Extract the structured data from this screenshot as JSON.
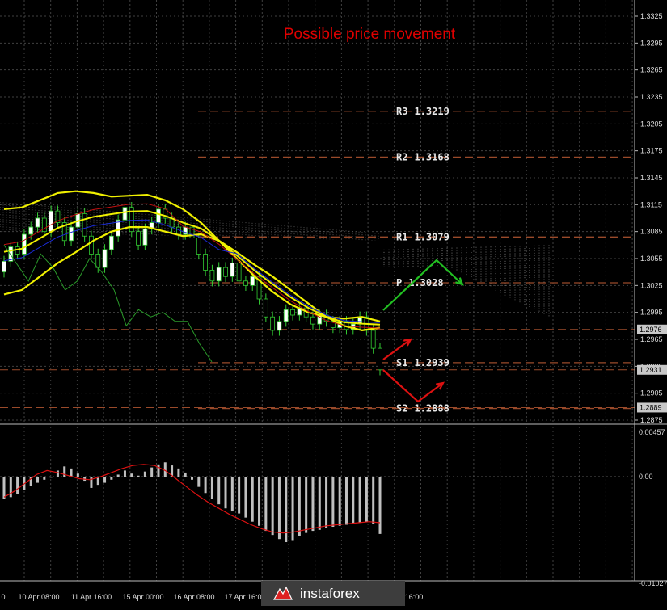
{
  "title": "Possible price movement",
  "colors": {
    "background": "#000000",
    "grid": "#404040",
    "title": "#e00000",
    "bands": "#f0f000",
    "green": "#22c022",
    "red": "#dd1111",
    "ma_red": "#c01010",
    "ma_blue": "#1a2bd8",
    "level": "#9a4a2a",
    "macd_hist": "#c0c0c0",
    "macd_signal": "#dd1111"
  },
  "price_axis": {
    "min": 1.2865,
    "max": 1.334,
    "ticks": [
      "1.3325",
      "1.3295",
      "1.3265",
      "1.3235",
      "1.3205",
      "1.3175",
      "1.3145",
      "1.3115",
      "1.3085",
      "1.3055",
      "1.3025",
      "1.2995",
      "1.2965",
      "1.2935",
      "1.2905",
      "1.2875"
    ],
    "tick_values": [
      1.3325,
      1.3295,
      1.3265,
      1.3235,
      1.3205,
      1.3175,
      1.3145,
      1.3115,
      1.3085,
      1.3055,
      1.3025,
      1.2995,
      1.2965,
      1.2935,
      1.2905,
      1.2875
    ],
    "badges": [
      {
        "label": "1.2976",
        "value": 1.2976
      },
      {
        "label": "1.2931",
        "value": 1.2931
      },
      {
        "label": "1.2889",
        "value": 1.2889
      }
    ]
  },
  "levels": [
    {
      "label": "R3",
      "value_text": "1.3219",
      "value": 1.3219
    },
    {
      "label": "R2",
      "value_text": "1.3168",
      "value": 1.3168
    },
    {
      "label": "R1",
      "value_text": "1.3079",
      "value": 1.3079
    },
    {
      "label": "P",
      "value_text": "1.3028",
      "value": 1.3028
    },
    {
      "label": "S1",
      "value_text": "1.2939",
      "value": 1.2939
    },
    {
      "label": "S2",
      "value_text": "1.2888",
      "value": 1.2888
    }
  ],
  "time_axis": [
    "0",
    "10 Apr 08:00",
    "11 Apr 16:00",
    "15 Apr 00:00",
    "16 Apr 08:00",
    "17 Apr 16:00",
    "16:00"
  ],
  "macd_axis": {
    "min": -0.01027,
    "max": 0.00457,
    "ticks": [
      "0.00457",
      "0.00",
      "-0.01027"
    ],
    "tick_values": [
      0.00457,
      0.0,
      -0.01027
    ]
  },
  "chart_data": [
    {
      "type": "line",
      "title": "Possible price movement",
      "x_labels": [
        "10 Apr 08:00",
        "11 Apr 16:00",
        "15 Apr 00:00",
        "16 Apr 08:00",
        "17 Apr 16:00"
      ],
      "candles": [
        {
          "o": 1.304,
          "c": 1.3052
        },
        {
          "o": 1.3052,
          "c": 1.3068
        },
        {
          "o": 1.3068,
          "c": 1.306
        },
        {
          "o": 1.306,
          "c": 1.3082
        },
        {
          "o": 1.3082,
          "c": 1.309
        },
        {
          "o": 1.309,
          "c": 1.31
        },
        {
          "o": 1.31,
          "c": 1.3085
        },
        {
          "o": 1.3085,
          "c": 1.3108
        },
        {
          "o": 1.3108,
          "c": 1.3095
        },
        {
          "o": 1.3095,
          "c": 1.3075
        },
        {
          "o": 1.3075,
          "c": 1.309
        },
        {
          "o": 1.309,
          "c": 1.3105
        },
        {
          "o": 1.3105,
          "c": 1.308
        },
        {
          "o": 1.308,
          "c": 1.306
        },
        {
          "o": 1.306,
          "c": 1.3045
        },
        {
          "o": 1.3045,
          "c": 1.3065
        },
        {
          "o": 1.3065,
          "c": 1.308
        },
        {
          "o": 1.308,
          "c": 1.3098
        },
        {
          "o": 1.3098,
          "c": 1.3112
        },
        {
          "o": 1.3112,
          "c": 1.3085
        },
        {
          "o": 1.3085,
          "c": 1.307
        },
        {
          "o": 1.307,
          "c": 1.3088
        },
        {
          "o": 1.3088,
          "c": 1.3095
        },
        {
          "o": 1.3095,
          "c": 1.311
        },
        {
          "o": 1.311,
          "c": 1.31
        },
        {
          "o": 1.31,
          "c": 1.309
        },
        {
          "o": 1.309,
          "c": 1.3082
        },
        {
          "o": 1.3082,
          "c": 1.309
        },
        {
          "o": 1.309,
          "c": 1.3078
        },
        {
          "o": 1.3078,
          "c": 1.306
        },
        {
          "o": 1.306,
          "c": 1.3042
        },
        {
          "o": 1.3042,
          "c": 1.303
        },
        {
          "o": 1.303,
          "c": 1.3045
        },
        {
          "o": 1.3045,
          "c": 1.3035
        },
        {
          "o": 1.3035,
          "c": 1.305
        },
        {
          "o": 1.305,
          "c": 1.303
        },
        {
          "o": 1.303,
          "c": 1.3025
        },
        {
          "o": 1.3025,
          "c": 1.3035
        },
        {
          "o": 1.3035,
          "c": 1.301
        },
        {
          "o": 1.301,
          "c": 1.299
        },
        {
          "o": 1.299,
          "c": 1.2975
        },
        {
          "o": 1.2975,
          "c": 1.2985
        },
        {
          "o": 1.2985,
          "c": 1.2998
        },
        {
          "o": 1.2998,
          "c": 1.2992
        },
        {
          "o": 1.2992,
          "c": 1.3
        },
        {
          "o": 1.3,
          "c": 1.299
        },
        {
          "o": 1.299,
          "c": 1.2982
        },
        {
          "o": 1.2982,
          "c": 1.2992
        },
        {
          "o": 1.2992,
          "c": 1.2985
        },
        {
          "o": 1.2985,
          "c": 1.2978
        },
        {
          "o": 1.2978,
          "c": 1.2985
        },
        {
          "o": 1.2985,
          "c": 1.2976
        },
        {
          "o": 1.2976,
          "c": 1.2982
        },
        {
          "o": 1.2982,
          "c": 1.299
        },
        {
          "o": 1.299,
          "c": 1.2975
        },
        {
          "o": 1.2975,
          "c": 1.2955
        },
        {
          "o": 1.2955,
          "c": 1.2931
        }
      ],
      "series": [
        {
          "name": "",
          "values": [
            1.3015,
            1.302,
            1.3035,
            1.305,
            1.3062,
            1.3075,
            1.3085,
            1.309,
            1.309,
            1.3085,
            1.308,
            1.3082,
            1.3075,
            1.3062,
            1.3048,
            1.3035,
            1.302,
            1.3005,
            1.299,
            1.298,
            1.2975,
            1.2978
          ]
        },
        {
          "name": "",
          "values": [
            1.311,
            1.3112,
            1.312,
            1.3128,
            1.313,
            1.3128,
            1.3124,
            1.3125,
            1.3126,
            1.312,
            1.311,
            1.3095,
            1.3075,
            1.3055,
            1.3035,
            1.3018,
            1.3004,
            1.2995,
            1.299,
            1.2988,
            1.299,
            1.2985
          ]
        }
      ]
    },
    {
      "type": "bar",
      "title": "",
      "values": [
        -0.0022,
        -0.002,
        -0.0017,
        -0.0013,
        -0.0009,
        -0.0006,
        -0.0003,
        -0.0001,
        0.0006,
        0.001,
        0.0008,
        0.0003,
        -0.0004,
        -0.0011,
        -0.0008,
        -0.0006,
        -0.0003,
        0.0002,
        0.0006,
        0.0003,
        0.0001,
        0.0005,
        0.0009,
        0.0012,
        0.0014,
        0.0011,
        0.0008,
        0.0004,
        -0.0003,
        -0.001,
        -0.0016,
        -0.0022,
        -0.0027,
        -0.0031,
        -0.0034,
        -0.0036,
        -0.004,
        -0.0044,
        -0.0048,
        -0.0053,
        -0.0057,
        -0.0061,
        -0.0064,
        -0.0062,
        -0.0058,
        -0.0055,
        -0.0053,
        -0.0052,
        -0.005,
        -0.0049,
        -0.0048,
        -0.0047,
        -0.0046,
        -0.0045,
        -0.0044,
        -0.0046,
        -0.0056
      ],
      "signal": [
        -0.002,
        -0.0014,
        -0.0006,
        0.0002,
        0.0006,
        0.0004,
        0.0001,
        -0.0002,
        -0.0003,
        0.0,
        0.0004,
        0.0008,
        0.0011,
        0.0012,
        0.0011,
        0.0006,
        -0.0002,
        -0.001,
        -0.0018,
        -0.0025,
        -0.0031,
        -0.0037,
        -0.0042,
        -0.0047,
        -0.0051,
        -0.0054,
        -0.0055,
        -0.0054,
        -0.0052,
        -0.005,
        -0.0048,
        -0.0047,
        -0.0046,
        -0.0045,
        -0.0044,
        -0.0045
      ]
    }
  ],
  "logo_text": "instaforex"
}
